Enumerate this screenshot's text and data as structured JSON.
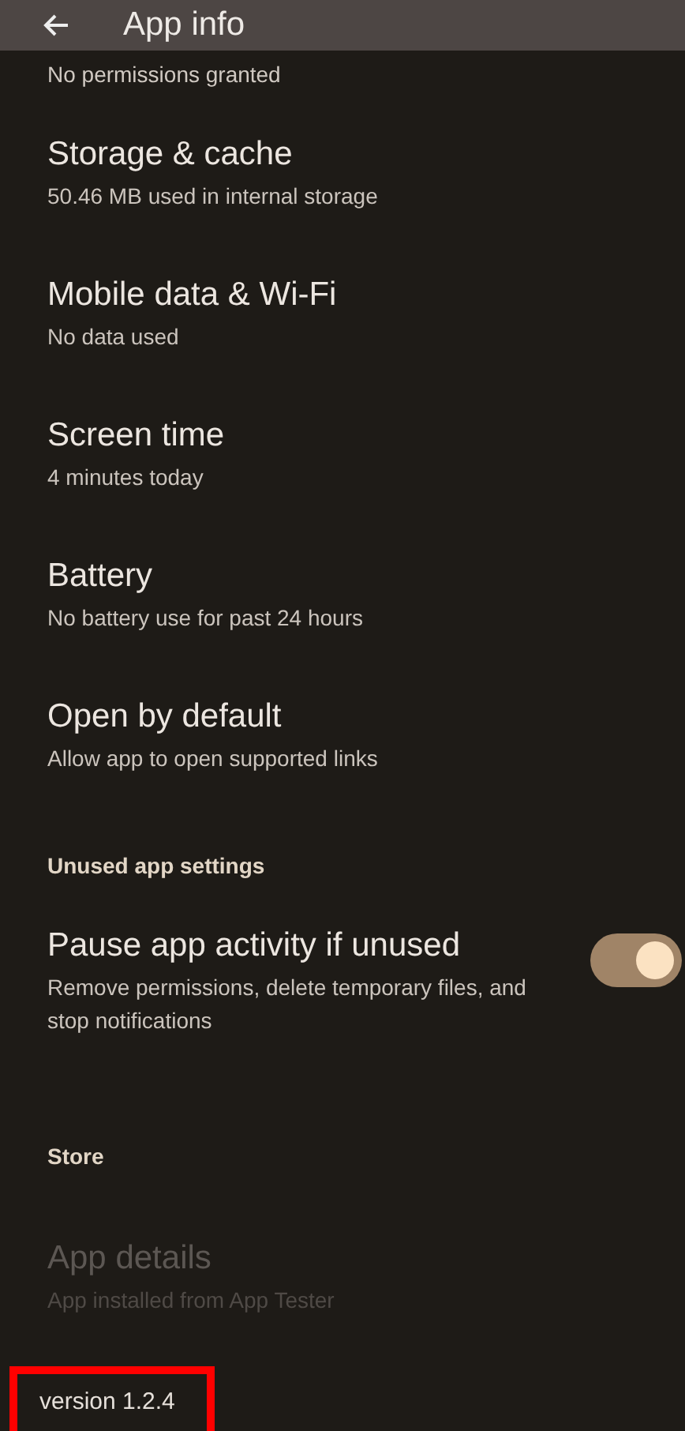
{
  "app_bar": {
    "title": "App info"
  },
  "items": [
    {
      "kind": "partial",
      "subtitle": "No permissions granted"
    },
    {
      "kind": "row",
      "title": "Storage & cache",
      "subtitle": "50.46 MB used in internal storage",
      "disabled": false
    },
    {
      "kind": "row",
      "title": "Mobile data & Wi-Fi",
      "subtitle": "No data used",
      "disabled": false
    },
    {
      "kind": "row",
      "title": "Screen time",
      "subtitle": "4 minutes today",
      "disabled": false
    },
    {
      "kind": "row",
      "title": "Battery",
      "subtitle": "No battery use for past 24 hours",
      "disabled": false
    },
    {
      "kind": "row",
      "title": "Open by default",
      "subtitle": "Allow app to open supported links",
      "disabled": false
    },
    {
      "kind": "section",
      "title": "Unused app settings"
    },
    {
      "kind": "switch",
      "title": "Pause app activity if unused",
      "subtitle": "Remove permissions, delete temporary files, and stop notifications",
      "on": true
    },
    {
      "kind": "section",
      "title": "Store"
    },
    {
      "kind": "row",
      "title": "App details",
      "subtitle": "App installed from App Tester",
      "disabled": true
    }
  ],
  "footer": {
    "version": "version 1.2.4",
    "highlighted": true
  }
}
